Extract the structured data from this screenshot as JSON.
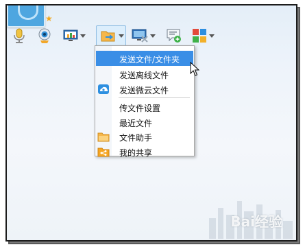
{
  "toolbar": {
    "buttons": [
      {
        "name": "microphone-icon"
      },
      {
        "name": "camera-icon"
      },
      {
        "name": "screen-share-icon"
      },
      {
        "name": "send-file-icon"
      },
      {
        "name": "remote-desktop-icon"
      },
      {
        "name": "add-chat-icon"
      },
      {
        "name": "apps-icon"
      }
    ]
  },
  "menu": {
    "items": [
      {
        "label": "发送文件/文件夹",
        "highlighted": true
      },
      {
        "label": "发送离线文件"
      },
      {
        "label": "发送微云文件",
        "icon": "weiyun-cloud-icon"
      },
      {
        "label": "传文件设置"
      },
      {
        "label": "最近文件"
      },
      {
        "label": "文件助手",
        "icon": "folder-icon"
      },
      {
        "label": "我的共享",
        "icon": "share-folder-icon"
      }
    ]
  },
  "watermark": {
    "text": "Bai经验"
  },
  "colors": {
    "highlight": "#3a8ee6",
    "accent_orange": "#f6a623",
    "accent_blue": "#2d8fe0"
  }
}
